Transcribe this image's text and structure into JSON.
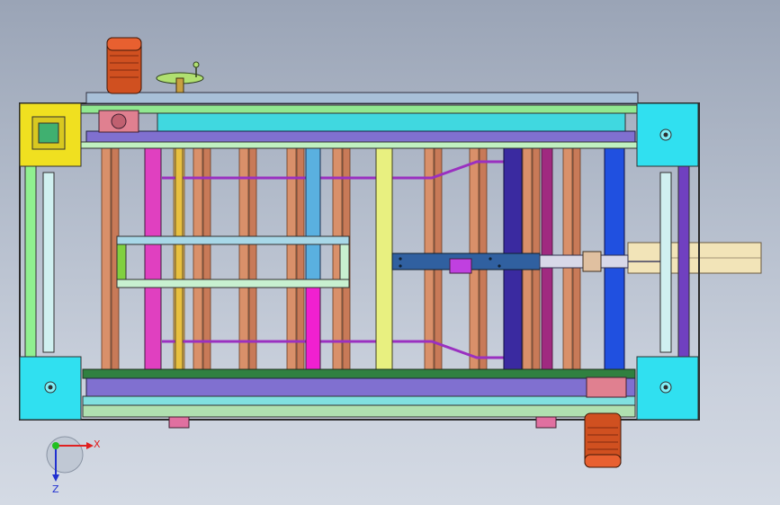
{
  "viewport": {
    "background_top": "#9aa4b6",
    "background_bottom": "#d4dae4"
  },
  "triad": {
    "x_label": "X",
    "z_label": "Z",
    "x_color": "#e02020",
    "z_color": "#2030d0",
    "y_color": "#20c020"
  },
  "colors": {
    "frame_green": "#7fe07f",
    "frame_cyan": "#40e0e8",
    "copper_roller": "#d08060",
    "magenta_bar": "#e040e0",
    "yellow_bar": "#e0e060",
    "navy_bar": "#2020a0",
    "blue_bar": "#2060e0",
    "motor_orange": "#d05020",
    "corner_block": "#30e0f0",
    "yellow_block": "#f0e020",
    "extension_plate": "#f0e0b0"
  }
}
